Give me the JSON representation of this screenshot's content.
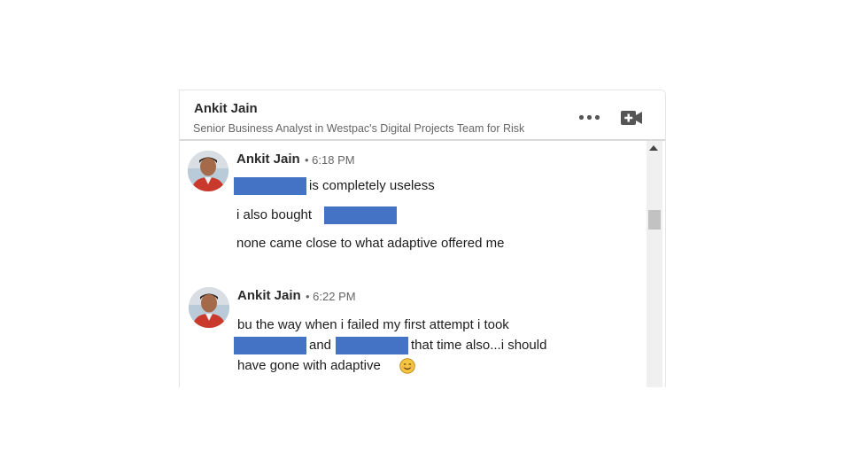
{
  "header": {
    "name": "Ankit Jain",
    "headline": "Senior Business Analyst in Westpac's Digital Projects Team for Risk",
    "more_icon": "more-horizontal-icon",
    "video_icon": "video-call-icon"
  },
  "colors": {
    "redaction": "#4472c4",
    "scroll_thumb": "#c2c2c2",
    "emoji_face": "#f5c542"
  },
  "messages": [
    {
      "sender": "Ankit Jain",
      "time": "• 6:18 PM",
      "lines": [
        "is completely useless",
        "i also bought",
        "none came close to what adaptive offered me"
      ]
    },
    {
      "sender": "Ankit Jain",
      "time": "• 6:22 PM",
      "lines": [
        "bu the way when i failed my first attempt i took",
        "and",
        "that time also...i should",
        "have gone with adaptive"
      ],
      "emoji": "smiling-face-emoji"
    }
  ]
}
